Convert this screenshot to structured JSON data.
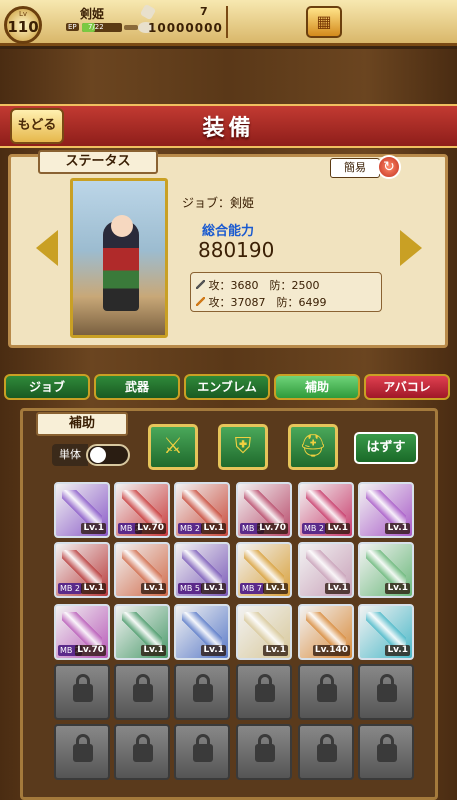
{
  "player": {
    "level_prefix": "Lv",
    "level": "110",
    "name": "剣姫",
    "exp_label": "EP",
    "exp_text": "7/22",
    "exp_fraction": 0.32,
    "stamina": "7",
    "coins": "10000000"
  },
  "header": {
    "back_label": "もどる",
    "title": "装備"
  },
  "status": {
    "tag": "ステータス",
    "simple_label": "簡易",
    "job": "ジョブ：剣姫",
    "power_label": "総合能力",
    "power_value": "880190",
    "row1": "攻：3680　防：2500",
    "row2": "攻：37087　防：6499"
  },
  "tabs": [
    {
      "label": "ジョブ"
    },
    {
      "label": "武器"
    },
    {
      "label": "エンブレム"
    },
    {
      "label": "補助"
    },
    {
      "label": "アバコレ"
    }
  ],
  "equip": {
    "tag": "補助",
    "single_label": "単体",
    "remove_label": "はずす",
    "slots": [
      {
        "lv": "Lv.1",
        "mb": "",
        "color": "#8a5ac8"
      },
      {
        "lv": "Lv.70",
        "mb": "MB 2",
        "color": "#c83a3a"
      },
      {
        "lv": "Lv.1",
        "mb": "MB 2",
        "color": "#c84a3a"
      },
      {
        "lv": "Lv.70",
        "mb": "MB 2",
        "color": "#b84a6a"
      },
      {
        "lv": "Lv.1",
        "mb": "MB 2",
        "color": "#c83a6a"
      },
      {
        "lv": "Lv.1",
        "mb": "",
        "color": "#a85ac8"
      },
      {
        "lv": "Lv.1",
        "mb": "MB 2",
        "color": "#b83a3a"
      },
      {
        "lv": "Lv.1",
        "mb": "",
        "color": "#d06a4a"
      },
      {
        "lv": "Lv.1",
        "mb": "MB 5",
        "color": "#7a5ab8"
      },
      {
        "lv": "Lv.1",
        "mb": "MB 7",
        "color": "#d8a03a"
      },
      {
        "lv": "Lv.1",
        "mb": "",
        "color": "#c8a0b8"
      },
      {
        "lv": "Lv.1",
        "mb": "",
        "color": "#6ab87a"
      },
      {
        "lv": "Lv.70",
        "mb": "MB 2",
        "color": "#b85ab8"
      },
      {
        "lv": "Lv.1",
        "mb": "",
        "color": "#4a9a6a"
      },
      {
        "lv": "Lv.1",
        "mb": "",
        "color": "#5a7ac8"
      },
      {
        "lv": "Lv.1",
        "mb": "",
        "color": "#d8c89a"
      },
      {
        "lv": "Lv.140",
        "mb": "",
        "color": "#d88a3a"
      },
      {
        "lv": "Lv.1",
        "mb": "",
        "color": "#4ab8c8"
      }
    ]
  },
  "colors": {
    "power_label": "#1a5ad0",
    "tab_active": "#2f9a3a",
    "tab_red": "#a01828",
    "banner": "#c23a32"
  }
}
